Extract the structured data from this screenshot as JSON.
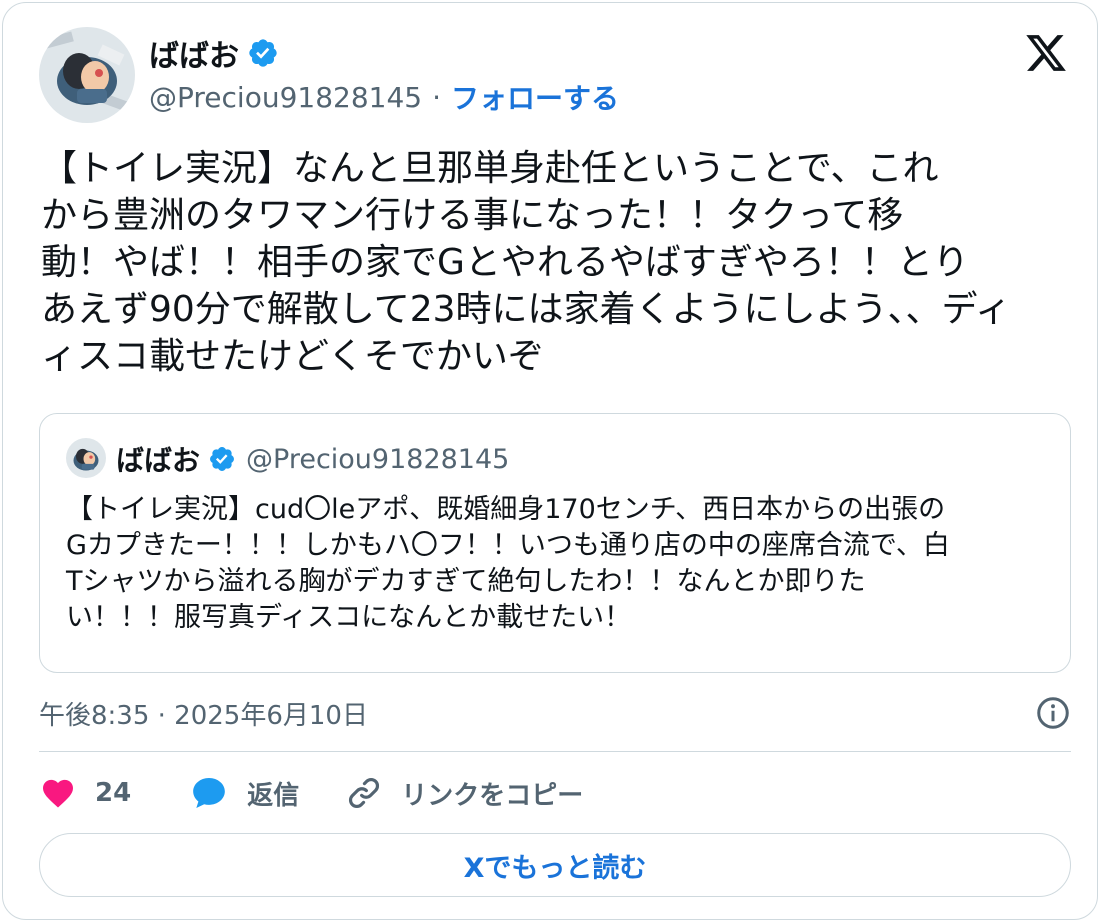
{
  "author": {
    "display_name": "ばばお",
    "handle": "@Preciou91828145",
    "separator": "·",
    "follow_label": "フォローする"
  },
  "tweet": {
    "text": "【トイレ実況】なんと旦那単身赴任ということで、これ\nから豊洲のタワマン行ける事になった！！タクって移\n動！やば！！相手の家でGとやれるやばすぎやろ！！とり\nあえず90分で解散して23時には家着くようにしよう、、ディ\nィスコ載せたけどくそでかいぞ"
  },
  "quoted_tweet": {
    "display_name": "ばばお",
    "handle": "@Preciou91828145",
    "text": "【トイレ実況】cud〇leアポ、既婚細身170センチ、西日本からの出張の\nGカプきたー！！！しかもハ〇フ！！いつも通り店の中の座席合流で、白\nTシャツから溢れる胸がデカすぎて絶句したわ！！なんとか即りた\nい！！！服写真ディスコになんとか載せたい！"
  },
  "meta": {
    "timestamp": "午後8:35 · 2025年6月10日"
  },
  "actions": {
    "like_count": "24",
    "reply_label": "返信",
    "copy_link_label": "リンクをコピー"
  },
  "read_more_label": "Xでもっと読む",
  "colors": {
    "accent": "#1a73d9",
    "like": "#f91880",
    "verified": "#1d9bf0",
    "secondary_text": "#536471",
    "border": "#cfd9de"
  },
  "icons": {
    "verified": "verified-badge-icon",
    "x_logo": "x-logo-icon",
    "info": "info-icon",
    "like": "heart-icon",
    "reply": "speech-bubble-icon",
    "copy_link": "link-icon"
  }
}
